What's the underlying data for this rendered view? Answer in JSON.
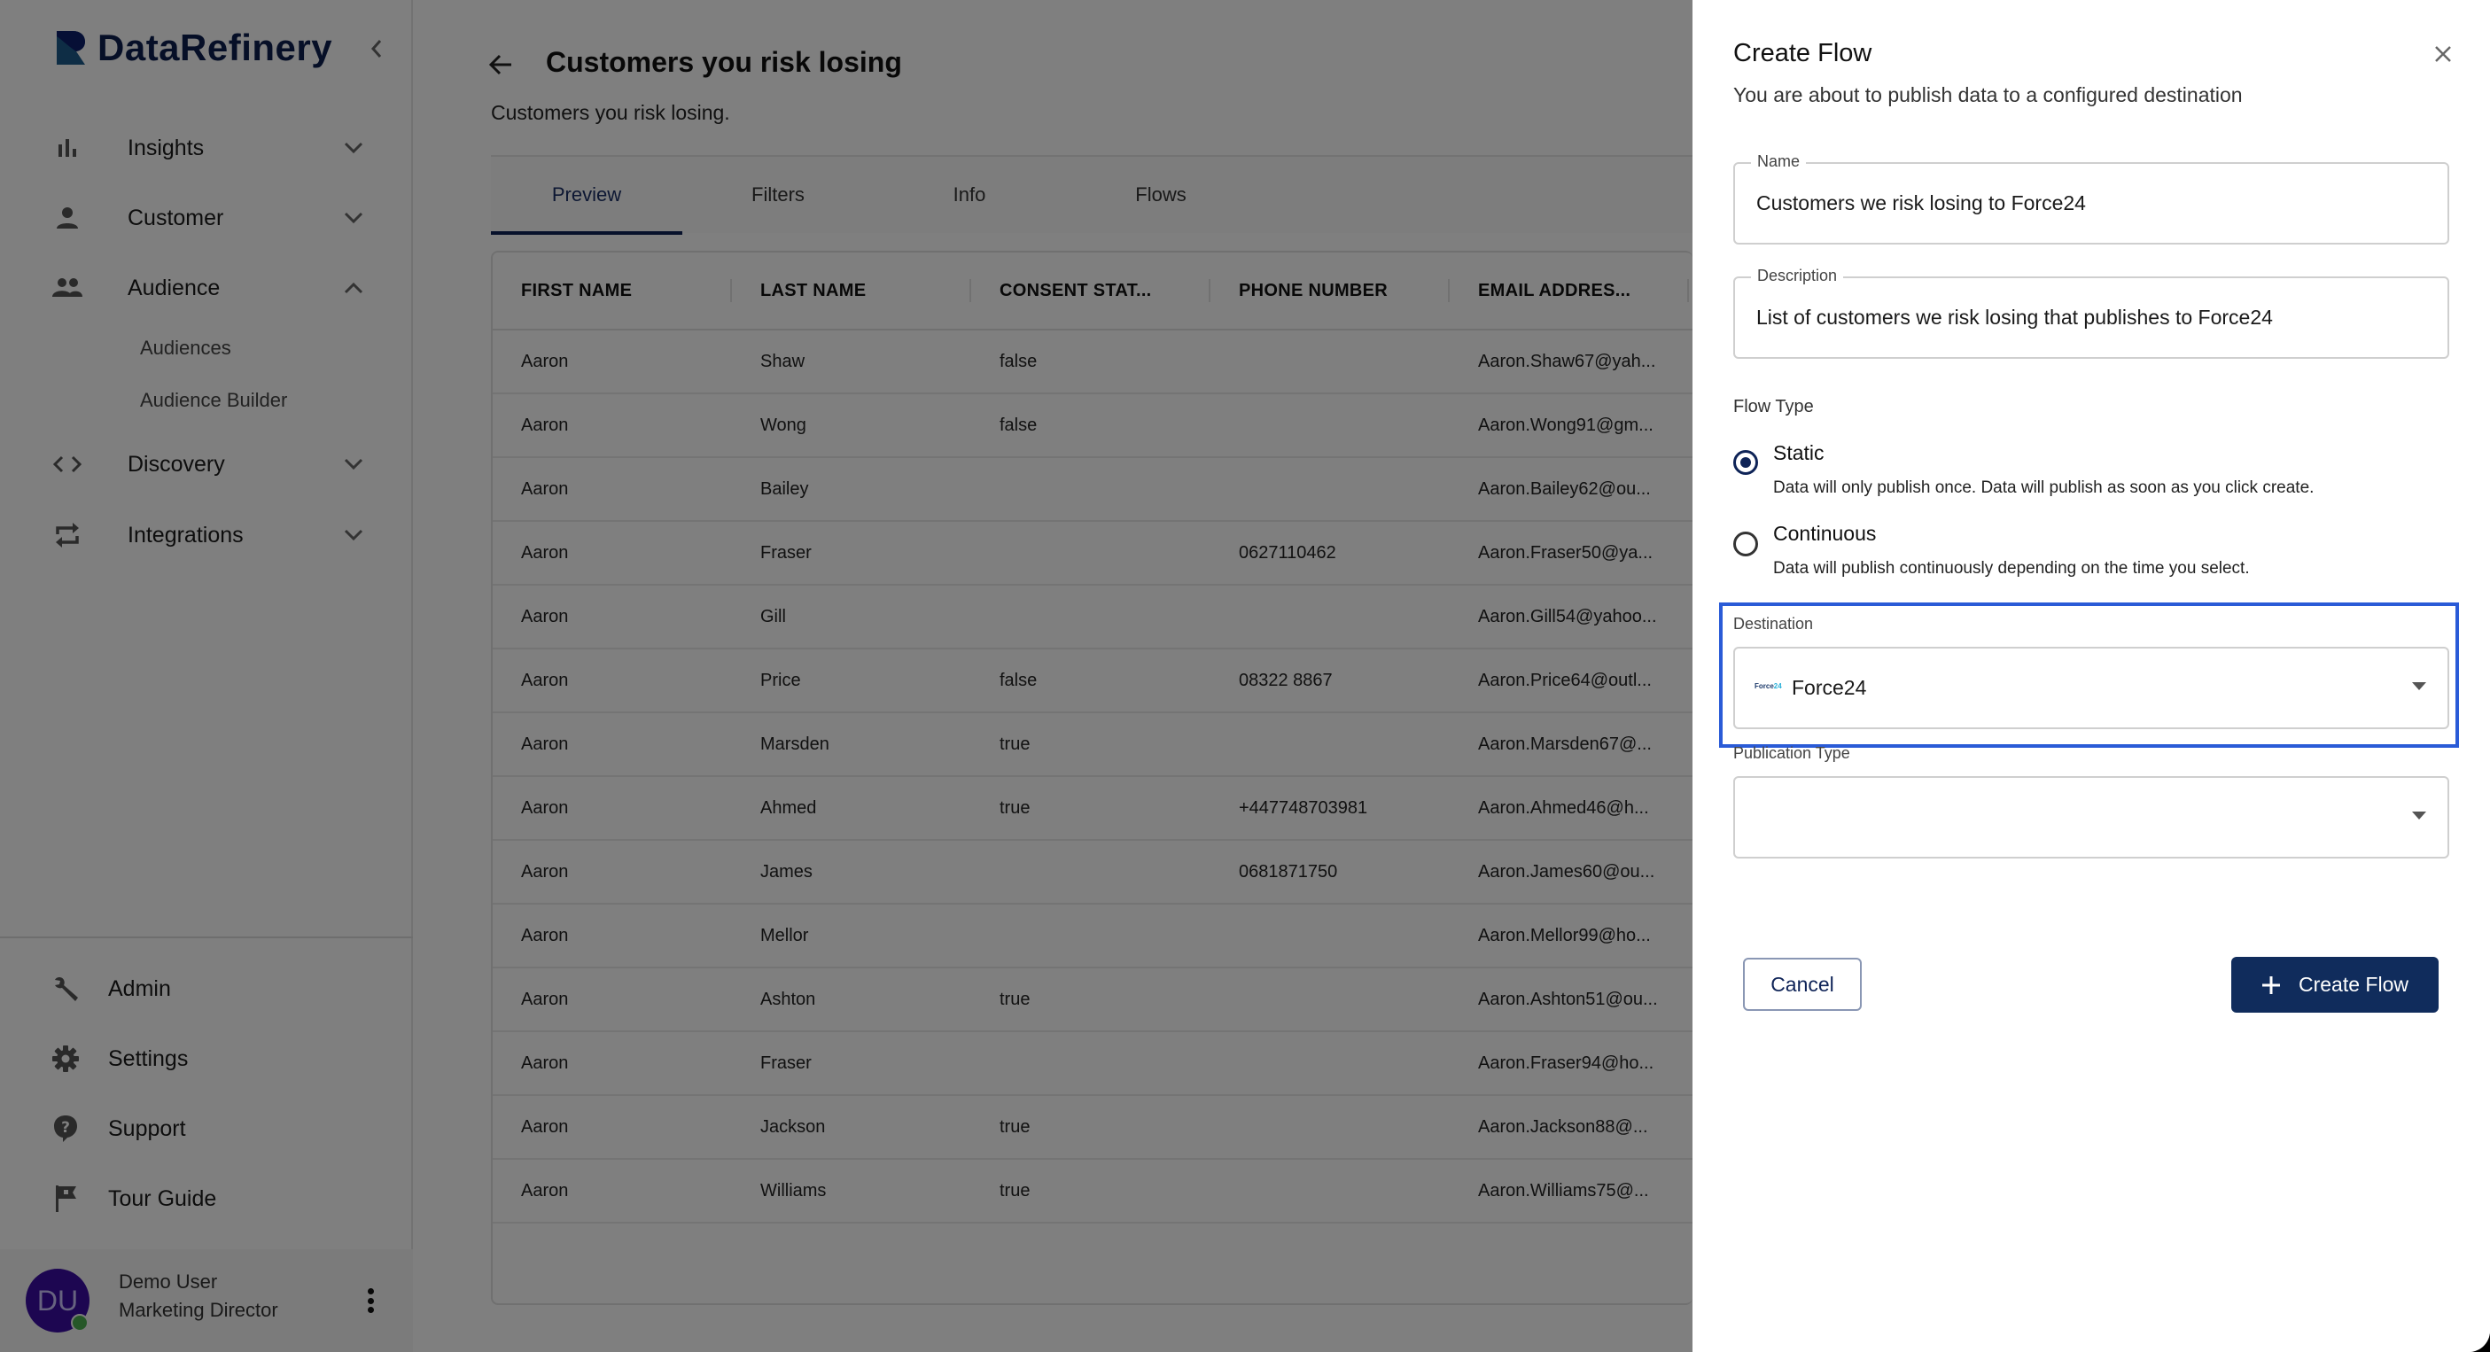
{
  "app": {
    "brand": "DataRefinery",
    "brand_color": "#0c1e4f",
    "accent_color": "#102c5c",
    "highlight_color": "#2a5bd7"
  },
  "sidebar": {
    "nav": [
      {
        "label": "Insights",
        "icon": "bar-chart-icon",
        "expanded": false
      },
      {
        "label": "Customer",
        "icon": "person-icon",
        "expanded": false
      },
      {
        "label": "Audience",
        "icon": "group-icon",
        "expanded": true,
        "children": [
          {
            "label": "Audiences"
          },
          {
            "label": "Audience Builder"
          }
        ]
      },
      {
        "label": "Discovery",
        "icon": "code-icon",
        "expanded": false
      },
      {
        "label": "Integrations",
        "icon": "repeat-icon",
        "expanded": false
      }
    ],
    "bottom": [
      {
        "label": "Admin",
        "icon": "wrench-icon"
      },
      {
        "label": "Settings",
        "icon": "gear-icon"
      },
      {
        "label": "Support",
        "icon": "help-icon"
      },
      {
        "label": "Tour Guide",
        "icon": "flag-icon"
      }
    ],
    "user": {
      "initials": "DU",
      "name": "Demo User",
      "role": "Marketing Director",
      "status": "online"
    }
  },
  "main": {
    "title": "Customers you risk losing",
    "subtitle": "Customers you risk losing.",
    "tabs": [
      {
        "label": "Preview",
        "active": true
      },
      {
        "label": "Filters",
        "active": false
      },
      {
        "label": "Info",
        "active": false
      },
      {
        "label": "Flows",
        "active": false
      }
    ],
    "table": {
      "columns": [
        "FIRST NAME",
        "LAST NAME",
        "CONSENT STAT...",
        "PHONE NUMBER",
        "EMAIL ADDRES..."
      ],
      "rows": [
        [
          "Aaron",
          "Shaw",
          "false",
          "",
          "Aaron.Shaw67@yah..."
        ],
        [
          "Aaron",
          "Wong",
          "false",
          "",
          "Aaron.Wong91@gm..."
        ],
        [
          "Aaron",
          "Bailey",
          "",
          "",
          "Aaron.Bailey62@ou..."
        ],
        [
          "Aaron",
          "Fraser",
          "",
          "0627110462",
          "Aaron.Fraser50@ya..."
        ],
        [
          "Aaron",
          "Gill",
          "",
          "",
          "Aaron.Gill54@yahoo..."
        ],
        [
          "Aaron",
          "Price",
          "false",
          "08322 8867",
          "Aaron.Price64@outl..."
        ],
        [
          "Aaron",
          "Marsden",
          "true",
          "",
          "Aaron.Marsden67@..."
        ],
        [
          "Aaron",
          "Ahmed",
          "true",
          "+447748703981",
          "Aaron.Ahmed46@h..."
        ],
        [
          "Aaron",
          "James",
          "",
          "0681871750",
          "Aaron.James60@ou..."
        ],
        [
          "Aaron",
          "Mellor",
          "",
          "",
          "Aaron.Mellor99@ho..."
        ],
        [
          "Aaron",
          "Ashton",
          "true",
          "",
          "Aaron.Ashton51@ou..."
        ],
        [
          "Aaron",
          "Fraser",
          "",
          "",
          "Aaron.Fraser94@ho..."
        ],
        [
          "Aaron",
          "Jackson",
          "true",
          "",
          "Aaron.Jackson88@..."
        ],
        [
          "Aaron",
          "Williams",
          "true",
          "",
          "Aaron.Williams75@..."
        ]
      ]
    }
  },
  "drawer": {
    "title": "Create Flow",
    "subtitle": "You are about to publish data to a configured destination",
    "name_field": {
      "label": "Name",
      "value": "Customers we risk losing to Force24"
    },
    "description_field": {
      "label": "Description",
      "value": "List of customers we risk losing that publishes to Force24"
    },
    "flow_type": {
      "label": "Flow Type",
      "options": [
        {
          "title": "Static",
          "description": "Data will only publish once. Data will publish as soon as you click create.",
          "selected": true
        },
        {
          "title": "Continuous",
          "description": "Data will publish continuously depending on the time you select.",
          "selected": false
        }
      ]
    },
    "destination": {
      "label": "Destination",
      "value": "Force24",
      "logo_text": "Force",
      "logo_accent": "24"
    },
    "publication_type": {
      "label": "Publication Type",
      "value": ""
    },
    "cancel_label": "Cancel",
    "create_label": "Create Flow"
  }
}
